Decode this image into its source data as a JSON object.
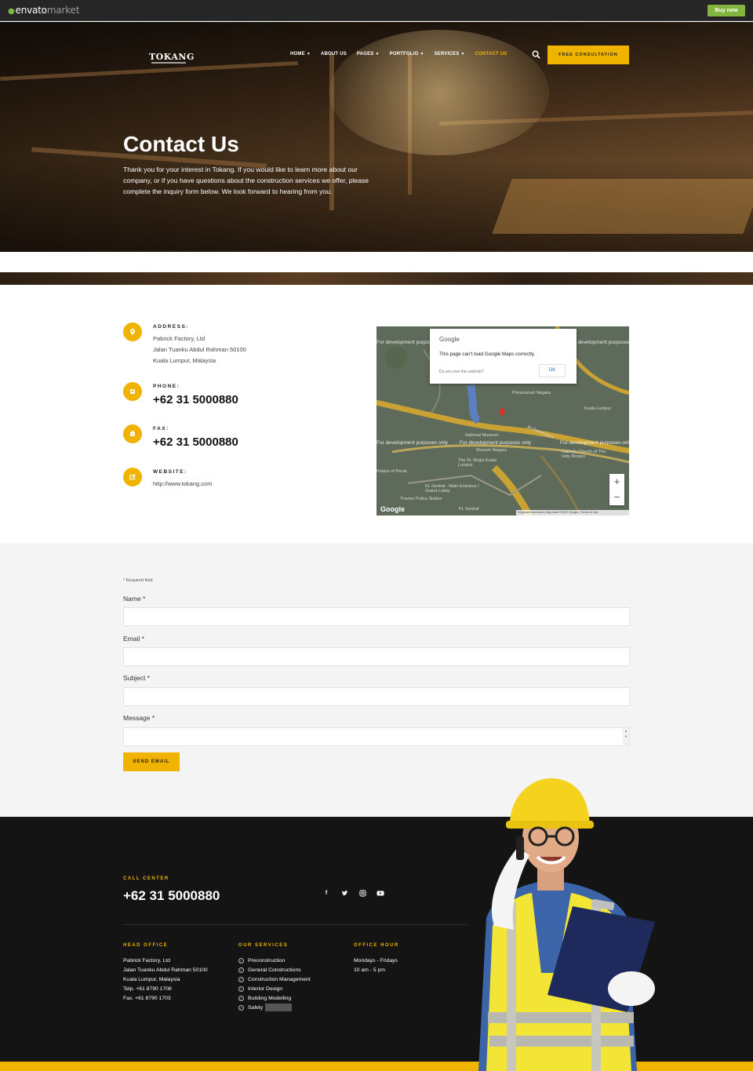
{
  "envato": {
    "logo_main": "envato",
    "logo_market": "market",
    "buy_label": "Buy now"
  },
  "header": {
    "logo": "TOKANG",
    "nav": [
      {
        "label": "HOME",
        "has_menu": true
      },
      {
        "label": "ABOUT US",
        "has_menu": false
      },
      {
        "label": "PAGES",
        "has_menu": true
      },
      {
        "label": "PORTFOLIO",
        "has_menu": true
      },
      {
        "label": "SERVICES",
        "has_menu": true
      },
      {
        "label": "CONTACT US",
        "has_menu": false
      }
    ],
    "cta_label": "FREE CONSULTATION"
  },
  "hero": {
    "title": "Contact Us",
    "text": "Thank you for your interest in Tokang. If you would like to learn more about our company, or if you have questions about the construction services we offer, please complete the inquiry form below. We look forward to hearing from you."
  },
  "contact": {
    "address_label": "ADDRESS:",
    "address_lines": [
      "Pabrick Factory, Ltd",
      "Jalan Tuanku Abdul Rahman 50100",
      "Kuala Lumpur, Malaysia"
    ],
    "phone_label": "PHONE:",
    "phone": "+62 31 5000880",
    "fax_label": "FAX:",
    "fax": "+62 31 5000880",
    "website_label": "WEBSITE:",
    "website": "http://www.tokang.com"
  },
  "map": {
    "dialog_brand": "Google",
    "dialog_message": "This page can't load Google Maps correctly.",
    "dialog_own": "Do you own this website?",
    "dialog_ok": "OK",
    "dev_text": "For development purposes only",
    "places": [
      "Planetarium Negara",
      "National Museum",
      "Muzium Negara",
      "Kuala Lumpur",
      "The St. Regis Kuala Lumpur",
      "Catholic Church of The Holy Rosary",
      "Palace of Perak",
      "KL Sentral - Main Entrance / Grand Lobby",
      "Travers Police Station",
      "KL Sentral",
      "Jln Damansara"
    ],
    "footer": "Keyboard shortcuts | Map data ©2022 Google | Terms of Use",
    "google_logo": "Google"
  },
  "form": {
    "required_note": "* Required field",
    "name_label": "Name *",
    "email_label": "Email *",
    "subject_label": "Subject *",
    "message_label": "Message *",
    "send_label": "SEND EMAIL"
  },
  "footer": {
    "call_label": "CALL CENTER",
    "phone": "+62 31 5000880",
    "socials": [
      "facebook-icon",
      "twitter-icon",
      "instagram-icon",
      "youtube-icon"
    ],
    "head_office": {
      "title": "HEAD OFFICE",
      "lines": [
        "Pabrick Factory, Ltd",
        "Jalan Tuanku Abdul Rahman 50100",
        "Kuala Lumpur, Malaysia",
        "Telp. +61 8790 1708",
        "Fax. +61 8790 1703"
      ]
    },
    "services": {
      "title": "OUR SERVICES",
      "items": [
        "Preconstruction",
        "General Constructions",
        "Construction Management",
        "Interior Design",
        "Building Modelling",
        "Safety"
      ]
    },
    "office_hour": {
      "title": "OFFICE HOUR",
      "lines": [
        "Mondays - Fridays",
        "10 am - 5 pm"
      ]
    }
  },
  "colors": {
    "accent": "#f0b400",
    "footer_bg": "#141414",
    "envato_green": "#82b440"
  }
}
